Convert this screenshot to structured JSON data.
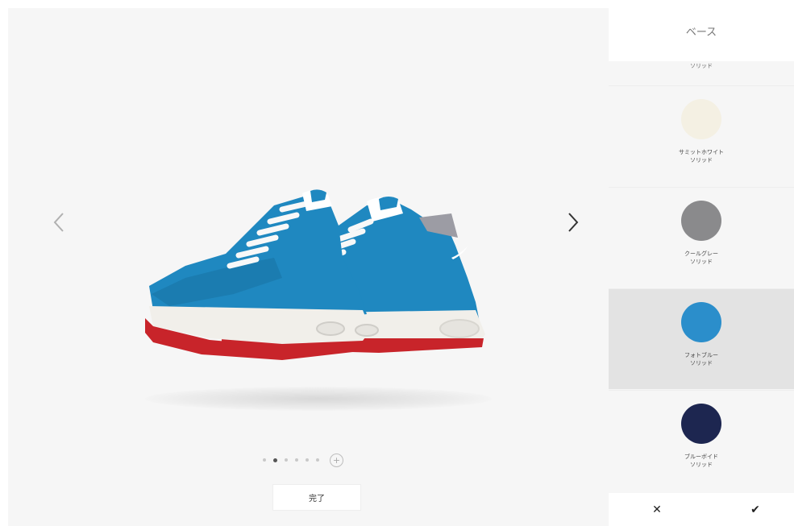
{
  "viewer": {
    "done_label": "完了",
    "plus_label": "+",
    "dot_count": 6,
    "active_dot": 1
  },
  "panel": {
    "title": "ベース",
    "partial_label": "ソリッド",
    "swatches": [
      {
        "name": "サミットホワイト",
        "finish": "ソリッド",
        "color": "#f4f0e3"
      },
      {
        "name": "クールグレー",
        "finish": "ソリッド",
        "color": "#8a8a8c"
      },
      {
        "name": "フォトブルー",
        "finish": "ソリッド",
        "color": "#2b8ecb"
      },
      {
        "name": "ブルーボイド",
        "finish": "ソリッド",
        "color": "#1d2650"
      }
    ],
    "selected_index": 2,
    "cancel_symbol": "✕",
    "confirm_symbol": "✔"
  },
  "colors": {
    "shoe_upper": "#1f88c0",
    "shoe_upper_dark": "#176f9f",
    "midsole": "#f1efea",
    "outsole": "#c8242a",
    "lace": "#f8f8f8"
  }
}
